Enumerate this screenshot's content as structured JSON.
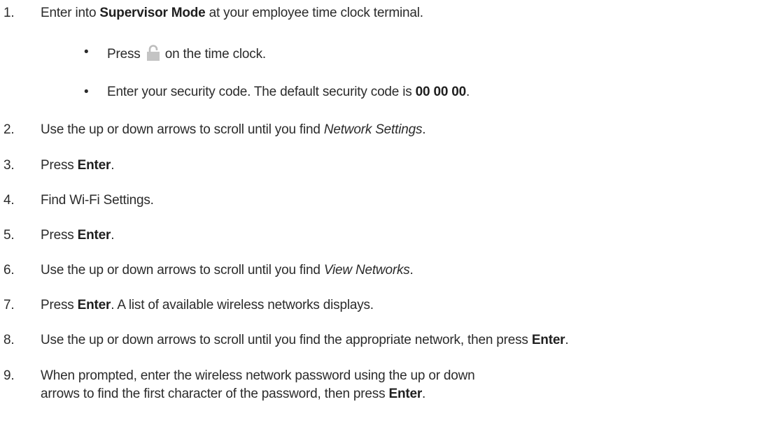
{
  "steps": [
    {
      "num": "1.",
      "pre": "Enter into ",
      "bold": "Supervisor Mode",
      "post": " at your employee time clock terminal."
    },
    {
      "num": "2.",
      "pre": "Use the up or down arrows to scroll until you find ",
      "italic": "Network Settings",
      "post": "."
    },
    {
      "num": "3.",
      "pre": "Press ",
      "bold": "Enter",
      "post": "."
    },
    {
      "num": "4.",
      "text": "Find Wi-Fi Settings."
    },
    {
      "num": "5.",
      "pre": "Press ",
      "bold": "Enter",
      "post": "."
    },
    {
      "num": "6.",
      "pre": "Use the up or down arrows to scroll until you find ",
      "italic": "View Networks",
      "post": "."
    },
    {
      "num": "7.",
      "pre": "Press ",
      "bold": "Enter",
      "post": ". A list of available wireless networks displays."
    },
    {
      "num": "8.",
      "pre": "Use the up or down arrows to scroll until you find the appropriate network, then press ",
      "bold": "Enter",
      "post": "."
    },
    {
      "num": "9.",
      "line1": "When prompted, enter the wireless network password using the up or down",
      "line2_pre": "arrows to find the first character of the password, then press ",
      "bold": "Enter",
      "post": "."
    }
  ],
  "substeps": [
    {
      "bullet": "•",
      "pre": "Press ",
      "icon": "lock-icon",
      "post": " on the time clock."
    },
    {
      "bullet": "•",
      "pre": "Enter your security code. The default security code is ",
      "bold": "00 00 00",
      "post": "."
    }
  ]
}
